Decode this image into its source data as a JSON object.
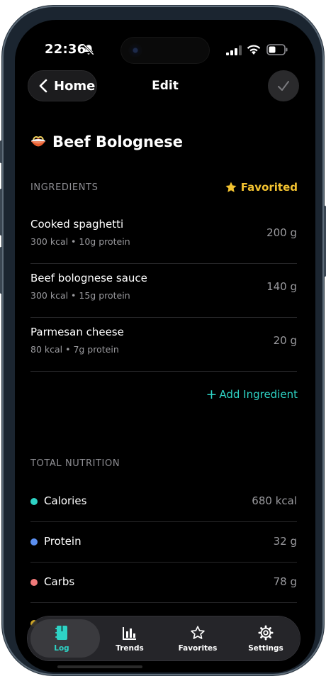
{
  "status": {
    "time": "22:36"
  },
  "nav": {
    "back_label": "Home",
    "title": "Edit"
  },
  "recipe": {
    "emoji_icon": "spaghetti-bowl-icon",
    "title": "Beef Bolognese"
  },
  "ingredients": {
    "section_label": "INGREDIENTS",
    "favorited_label": "Favorited",
    "items": [
      {
        "name": "Cooked spaghetti",
        "sub": "300 kcal • 10g protein",
        "weight": "200 g"
      },
      {
        "name": "Beef bolognese sauce",
        "sub": "300 kcal • 15g protein",
        "weight": "140 g"
      },
      {
        "name": "Parmesan cheese",
        "sub": "80 kcal • 7g protein",
        "weight": "20 g"
      }
    ],
    "add_label": "Add Ingredient"
  },
  "nutrition": {
    "section_label": "TOTAL NUTRITION",
    "items": [
      {
        "label": "Calories",
        "value": "680 kcal",
        "color": "#2ed3c5"
      },
      {
        "label": "Protein",
        "value": "32 g",
        "color": "#5b8ff0"
      },
      {
        "label": "Carbs",
        "value": "78 g",
        "color": "#f07a7a"
      }
    ]
  },
  "tabs": [
    {
      "label": "Log",
      "icon": "log-book-icon",
      "active": true
    },
    {
      "label": "Trends",
      "icon": "bar-chart-icon"
    },
    {
      "label": "Favorites",
      "icon": "star-icon"
    },
    {
      "label": "Settings",
      "icon": "gear-icon"
    }
  ],
  "colors": {
    "accent": "#2ed3c5",
    "favorite": "#f2c230",
    "background": "#000000"
  }
}
